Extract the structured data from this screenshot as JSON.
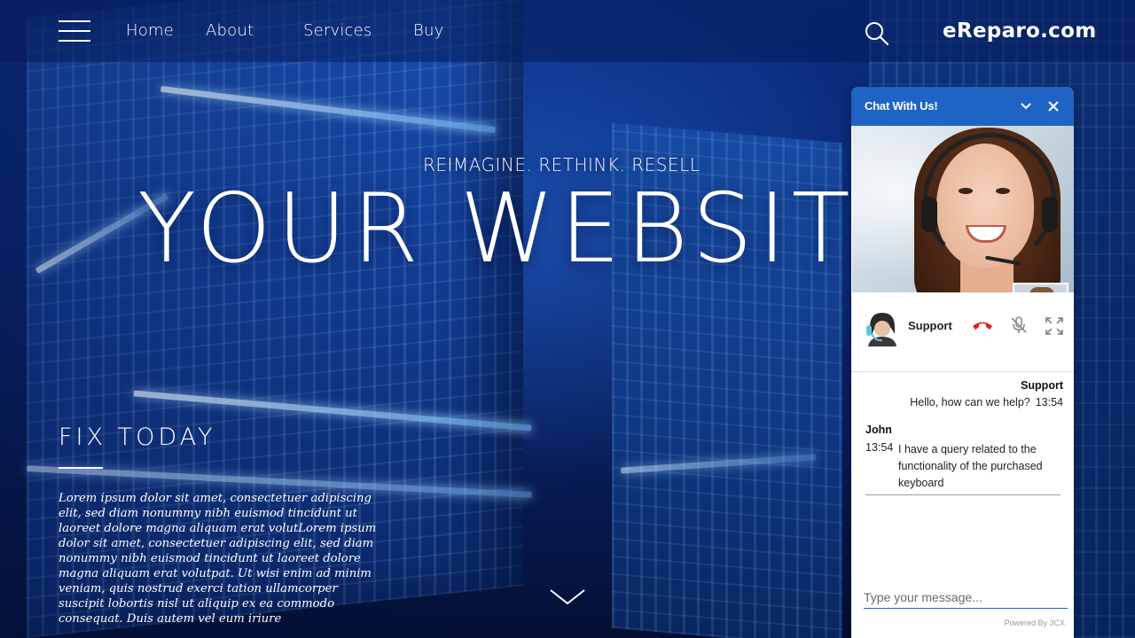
{
  "nav": {
    "links": [
      "Home",
      "About",
      "Services",
      "Buy"
    ],
    "brand": "eReparo.com"
  },
  "hero": {
    "tagline": "REIMAGINE. RETHINK. RESELL",
    "headline": "YOUR WEBSITE",
    "section_title": "FIX TODAY",
    "body": "Lorem ipsum dolor sit amet, consectetuer adipiscing elit, sed diam nonummy nibh euismod tincidunt ut laoreet dolore magna aliquam erat volutLorem ipsum dolor sit amet, consectetuer adipiscing elit, sed diam nonummy nibh euismod tincidunt ut laoreet dolore magna aliquam erat volutpat. Ut wisi enim ad minim veniam, quis nostrud exerci tation ullamcorper suscipit lobortis nisl ut aliquip ex ea commodo consequat. Duis autem vel eum iriure"
  },
  "chat": {
    "title": "Chat With Us!",
    "agent_name": "Support",
    "messages": [
      {
        "sender": "Support",
        "time": "13:54",
        "text": "Hello, how can we help?"
      },
      {
        "sender": "John",
        "time": "13:54",
        "text": "I have a query related to the functionality of the purchased keyboard"
      }
    ],
    "input_placeholder": "Type your message...",
    "powered_by": "Powered By 3CX"
  },
  "colors": {
    "chat_header": "#1f63c5",
    "hangup_red": "#e02020",
    "hero_blue": "#0b2f86"
  },
  "icons": [
    "menu-icon",
    "search-icon",
    "chevron-down-icon",
    "close-icon",
    "phone-hangup-icon",
    "mic-off-icon",
    "fullscreen-icon",
    "scroll-down-chevron-icon"
  ]
}
